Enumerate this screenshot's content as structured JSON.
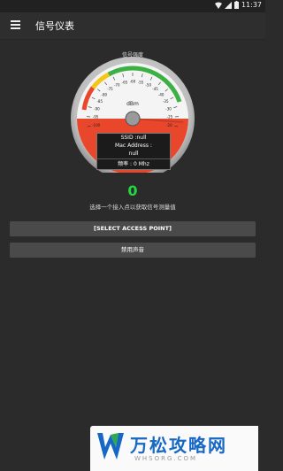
{
  "status_bar": {
    "time": "11:37",
    "icons": [
      "wifi-icon",
      "signal-icon",
      "battery-icon"
    ]
  },
  "app_bar": {
    "title": "信号仪表",
    "menu_icon": "menu-icon"
  },
  "gauge": {
    "title": "信号强度",
    "scale_labels": [
      "-100",
      "-95",
      "-90",
      "-85",
      "-80",
      "-75",
      "-70",
      "-65",
      "-60",
      "-55",
      "-50",
      "-45",
      "-40",
      "-35",
      "-30",
      "-25",
      "-20"
    ],
    "unit": "dBm",
    "needle_value": -100,
    "ssid": "SSID :null",
    "mac_label": "Mac Address :",
    "mac_value": "null",
    "freq_label": "频率 :",
    "freq_value": "0 Mhz",
    "colors": {
      "red": "#e8472b",
      "yellow": "#f5c518",
      "green": "#3cb043"
    }
  },
  "signal_value": "0",
  "hint_text": "选择一个接入点以获取信号测量值",
  "buttons": {
    "select_ap": "[SELECT ACCESS POINT]",
    "sound": "禁用声音"
  },
  "banner": {
    "brand": "万松攻略网",
    "domain": "WHSORG.COM"
  }
}
